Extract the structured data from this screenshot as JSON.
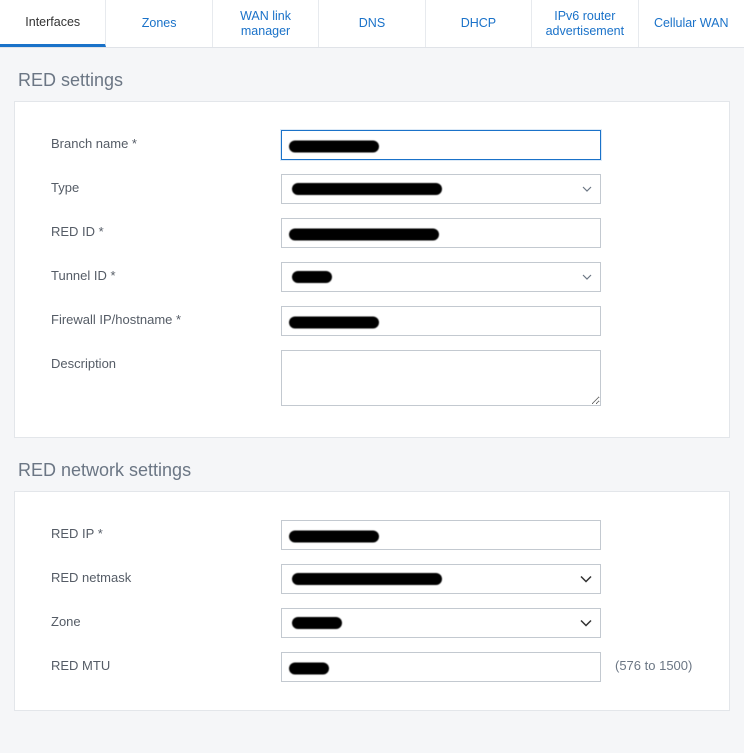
{
  "tabs": {
    "interfaces": "Interfaces",
    "zones": "Zones",
    "wan_link_manager": "WAN link manager",
    "dns": "DNS",
    "dhcp": "DHCP",
    "ipv6_router_advertisement": "IPv6 router advertisement",
    "cellular_wan": "Cellular WAN"
  },
  "section1": {
    "title": "RED settings",
    "fields": {
      "branch_name": {
        "label": "Branch name *",
        "value": ""
      },
      "type": {
        "label": "Type",
        "value": ""
      },
      "red_id": {
        "label": "RED ID *",
        "value": ""
      },
      "tunnel_id": {
        "label": "Tunnel ID *",
        "value": ""
      },
      "firewall_ip_hostname": {
        "label": "Firewall IP/hostname *",
        "value": ""
      },
      "description": {
        "label": "Description",
        "value": ""
      }
    }
  },
  "section2": {
    "title": "RED network settings",
    "fields": {
      "red_ip": {
        "label": "RED IP *",
        "value": ""
      },
      "red_netmask": {
        "label": "RED netmask",
        "value": ""
      },
      "zone": {
        "label": "Zone",
        "value": ""
      },
      "red_mtu": {
        "label": "RED MTU",
        "value": "",
        "hint": "(576 to 1500)"
      }
    }
  }
}
